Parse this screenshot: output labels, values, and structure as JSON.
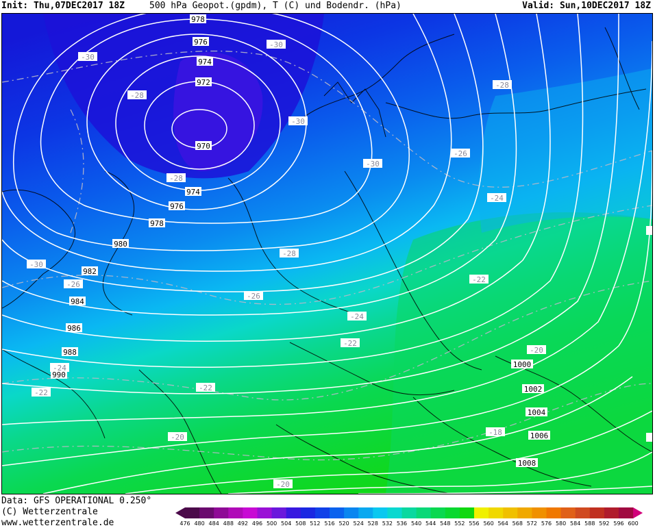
{
  "header": {
    "init": "Init: Thu,07DEC2017 18Z",
    "parameter": "500 hPa Geopot.(gpdm), T (C) und Bodendr. (hPa)",
    "valid": "Valid: Sun,10DEC2017 18Z"
  },
  "footer": {
    "data_source": "Data: GFS OPERATIONAL 0.250°",
    "copyright": "(C) Wetterzentrale",
    "website": "www.wetterzentrale.de"
  },
  "color_scale": {
    "values": [
      "476",
      "480",
      "484",
      "488",
      "492",
      "496",
      "500",
      "504",
      "508",
      "512",
      "516",
      "520",
      "524",
      "528",
      "532",
      "536",
      "540",
      "544",
      "548",
      "552",
      "556",
      "560",
      "564",
      "568",
      "572",
      "576",
      "580",
      "584",
      "588",
      "592",
      "596",
      "600"
    ],
    "colors": [
      "#4b0a4a",
      "#6a0a6e",
      "#8f0a96",
      "#b00ab8",
      "#c80ad4",
      "#9a10d6",
      "#6a18dc",
      "#3818e0",
      "#1a28e2",
      "#1040e8",
      "#0a62ee",
      "#0a86f0",
      "#0aa8f0",
      "#0ac8f0",
      "#0ad8d0",
      "#0ad8a0",
      "#0ad878",
      "#0ad850",
      "#0ad830",
      "#10d810",
      "#f0f000",
      "#f0d800",
      "#f0c000",
      "#f0a800",
      "#f09000",
      "#f07800",
      "#e06018",
      "#d04a20",
      "#c03020",
      "#b01c2c",
      "#a00a40",
      "#d2007a"
    ]
  },
  "map": {
    "isobars_hpa": [
      {
        "label": "970",
        "lx": 0,
        "ly": 0
      },
      {
        "label": "972"
      },
      {
        "label": "974"
      },
      {
        "label": "976"
      },
      {
        "label": "978"
      },
      {
        "label": "980"
      },
      {
        "label": "982"
      },
      {
        "label": "984"
      },
      {
        "label": "986"
      },
      {
        "label": "988"
      },
      {
        "label": "990"
      },
      {
        "label": "1000"
      },
      {
        "label": "1002"
      },
      {
        "label": "1004"
      },
      {
        "label": "1006"
      },
      {
        "label": "1008"
      }
    ],
    "temperature_labels_c": [
      "-30",
      "-30",
      "-28",
      "-30",
      "-30",
      "-28",
      "-26",
      "-28",
      "-24",
      "-30",
      "-26",
      "-28",
      "-26",
      "-24",
      "-22",
      "-22",
      "-24",
      "-22",
      "-22",
      "-20",
      "-20",
      "-18",
      "-20",
      "-20"
    ]
  }
}
